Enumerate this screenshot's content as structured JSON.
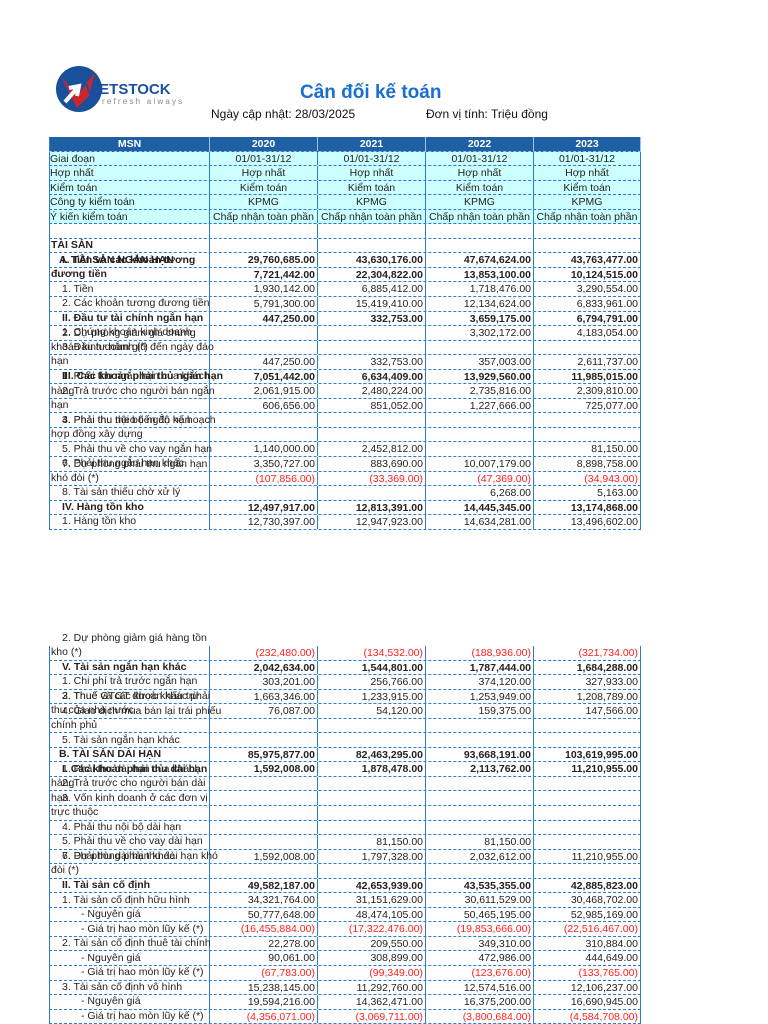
{
  "brand": {
    "name": "VIETSTOCK",
    "tagline": "refresh always",
    "color": "#1a4f9c",
    "accent": "#e02020"
  },
  "header": {
    "title": "Cân đối kế toán",
    "updated": "Ngày cập nhật: 28/03/2025",
    "unit": "Đơn vị tính: Triệu đồng"
  },
  "table": {
    "columns": [
      "MSN",
      "2020",
      "2021",
      "2022",
      "2023"
    ],
    "meta": [
      {
        "label": "Giai đoạn",
        "values": [
          "01/01-31/12",
          "01/01-31/12",
          "01/01-31/12",
          "01/01-31/12"
        ]
      },
      {
        "label": "Hợp nhất",
        "values": [
          "Hợp nhất",
          "Hợp nhất",
          "Hợp nhất",
          "Hợp nhất"
        ]
      },
      {
        "label": "Kiểm toán",
        "values": [
          "Kiểm toán",
          "Kiểm toán",
          "Kiểm toán",
          "Kiểm toán"
        ]
      },
      {
        "label": "Công ty kiểm toán",
        "values": [
          "KPMG",
          "KPMG",
          "KPMG",
          "KPMG"
        ]
      },
      {
        "label": "Ý kiến kiểm toán",
        "values": [
          "Chấp nhận toàn phần",
          "Chấp nhận toàn phần",
          "Chấp nhận toàn phần",
          "Chấp nhận toàn phần"
        ]
      }
    ],
    "rows_part1": [
      {
        "label": "",
        "kind": "section",
        "bold": false,
        "values": [
          "",
          "",
          "",
          ""
        ]
      },
      {
        "label": "TÀI SẢN",
        "kind": "section",
        "bold": true,
        "values": [
          "",
          "",
          "",
          ""
        ]
      },
      {
        "label": "A. TÀI SẢN NGẮN HẠN",
        "kind": "group",
        "bold": true,
        "values": [
          "29,760,685.00",
          "43,630,176.00",
          "47,674,624.00",
          "43,763,477.00"
        ]
      },
      {
        "label": "I. Tiền và các khoản tương đương tiền",
        "kind": "item",
        "bold": true,
        "values": [
          "7,721,442.00",
          "22,304,822.00",
          "13,853,100.00",
          "10,124,515.00"
        ]
      },
      {
        "label": "1. Tiền",
        "kind": "item",
        "bold": false,
        "values": [
          "1,930,142.00",
          "6,885,412.00",
          "1,718,476.00",
          "3,290,554.00"
        ]
      },
      {
        "label": "2. Các khoản tương đương tiền",
        "kind": "item",
        "bold": false,
        "values": [
          "5,791,300.00",
          "15,419,410.00",
          "12,134,624.00",
          "6,833,961.00"
        ]
      },
      {
        "label": "II.  Đầu tư tài chính ngắn hạn",
        "kind": "item",
        "bold": true,
        "values": [
          "447,250.00",
          "332,753.00",
          "3,659,175.00",
          "6,794,791.00"
        ]
      },
      {
        "label": "1. Chứng khoán kinh doanh",
        "kind": "item",
        "bold": false,
        "values": [
          "",
          "",
          "3,302,172.00",
          "4,183,054.00"
        ]
      },
      {
        "label": "2. Dự phòng giảm giá chứng khoán kinh doanh (*)",
        "kind": "item",
        "bold": false,
        "values": [
          "",
          "",
          "",
          ""
        ]
      },
      {
        "label": "3. Đầu tư nắm giữ đến ngày đáo hạn",
        "kind": "item",
        "bold": false,
        "values": [
          "447,250.00",
          "332,753.00",
          "357,003.00",
          "2,611,737.00"
        ]
      },
      {
        "label": "III. Các khoản phải thu ngắn hạn",
        "kind": "item",
        "bold": true,
        "values": [
          "7,051,442.00",
          "6,634,409.00",
          "13,929,560.00",
          "11,985,015.00"
        ]
      },
      {
        "label": "1. Phải thu ngắn hạn của khách hàng",
        "kind": "item",
        "bold": false,
        "values": [
          "2,061,915.00",
          "2,480,224.00",
          "2,735,816.00",
          "2,309,810.00"
        ]
      },
      {
        "label": "2. Trả trước cho người bán ngắn hạn",
        "kind": "item",
        "bold": false,
        "values": [
          "606,656.00",
          "851,052.00",
          "1,227,666.00",
          "725,077.00"
        ]
      },
      {
        "label": "3. Phải thu nội bộ ngắn hạn",
        "kind": "item",
        "bold": false,
        "values": [
          "",
          "",
          "",
          ""
        ]
      },
      {
        "label": "4. Phải thu theo tiến độ kế hoạch hợp đồng xây dựng",
        "kind": "item",
        "bold": false,
        "values": [
          "",
          "",
          "",
          ""
        ]
      },
      {
        "label": "5. Phải thu về cho vay ngắn hạn",
        "kind": "item",
        "bold": false,
        "values": [
          "1,140,000.00",
          "2,452,812.00",
          "",
          "81,150.00"
        ]
      },
      {
        "label": "6. Phải thu ngắn hạn khác",
        "kind": "item",
        "bold": false,
        "values": [
          "3,350,727.00",
          "883,690.00",
          "10,007,179.00",
          "8,898,758.00"
        ]
      },
      {
        "label": "7. Dự phòng phải thu ngắn hạn khó đòi (*)",
        "kind": "item",
        "bold": false,
        "values": [
          "(107,856.00)",
          "(33,369.00)",
          "(47,369.00)",
          "(34,943.00)"
        ]
      },
      {
        "label": "8. Tài sản thiếu chờ xử lý",
        "kind": "item",
        "bold": false,
        "values": [
          "",
          "",
          "6,268.00",
          "5,163.00"
        ]
      },
      {
        "label": "IV. Hàng tồn kho",
        "kind": "item",
        "bold": true,
        "values": [
          "12,497,917.00",
          "12,813,391.00",
          "14,445,345.00",
          "13,174,868.00"
        ]
      },
      {
        "label": "1. Hàng tồn kho",
        "kind": "item",
        "bold": false,
        "values": [
          "12,730,397.00",
          "12,947,923.00",
          "14,634,281.00",
          "13,496,602.00"
        ]
      }
    ],
    "rows_part2": [
      {
        "label": "2. Dự phòng giảm giá hàng tồn kho (*)",
        "kind": "item",
        "bold": false,
        "values": [
          "(232,480.00)",
          "(134,532.00)",
          "(188,936.00)",
          "(321,734.00)"
        ]
      },
      {
        "label": "V. Tài sản ngắn hạn khác",
        "kind": "item",
        "bold": true,
        "values": [
          "2,042,634.00",
          "1,544,801.00",
          "1,787,444.00",
          "1,684,288.00"
        ]
      },
      {
        "label": "1. Chi phí trả trước ngắn hạn",
        "kind": "item",
        "bold": false,
        "values": [
          "303,201.00",
          "256,766.00",
          "374,120.00",
          "327,933.00"
        ]
      },
      {
        "label": "2. Thuế GTGT được khấu trừ",
        "kind": "item",
        "bold": false,
        "values": [
          "1,663,346.00",
          "1,233,915.00",
          "1,253,949.00",
          "1,208,789.00"
        ]
      },
      {
        "label": "3. Thuế và các khoản khác phải thu của nhà nước",
        "kind": "item",
        "bold": false,
        "values": [
          "76,087.00",
          "54,120.00",
          "159,375.00",
          "147,566.00"
        ]
      },
      {
        "label": "4. Giao dịch mua bán lại trái phiếu chính phủ",
        "kind": "item",
        "bold": false,
        "values": [
          "",
          "",
          "",
          ""
        ]
      },
      {
        "label": "5. Tài sản ngắn hạn khác",
        "kind": "item",
        "bold": false,
        "values": [
          "",
          "",
          "",
          ""
        ]
      },
      {
        "label": "B. TÀI SẢN DÀI HẠN",
        "kind": "group",
        "bold": true,
        "values": [
          "85,975,877.00",
          "82,463,295.00",
          "93,668,191.00",
          "103,619,995.00"
        ]
      },
      {
        "label": "I. Các khoản phải thu dài hạn",
        "kind": "item",
        "bold": true,
        "values": [
          "1,592,008.00",
          "1,878,478.00",
          "2,113,762.00",
          "11,210,955.00"
        ]
      },
      {
        "label": "1. Phải thu dài hạn của khách hàng",
        "kind": "item",
        "bold": false,
        "values": [
          "",
          "",
          "",
          ""
        ]
      },
      {
        "label": "2. Trả trước cho người bán dài hạn",
        "kind": "item",
        "bold": false,
        "values": [
          "",
          "",
          "",
          ""
        ]
      },
      {
        "label": "3. Vốn kinh doanh ở các đơn vị trực thuộc",
        "kind": "item",
        "bold": false,
        "values": [
          "",
          "",
          "",
          ""
        ]
      },
      {
        "label": "4.  Phải thu nội bộ dài hạn",
        "kind": "item",
        "bold": false,
        "values": [
          "",
          "",
          "",
          ""
        ]
      },
      {
        "label": "5. Phải thu về cho vay dài hạn",
        "kind": "item",
        "bold": false,
        "values": [
          "",
          "81,150.00",
          "81,150.00",
          ""
        ]
      },
      {
        "label": "6. Phải thu dài hạn khác",
        "kind": "item",
        "bold": false,
        "values": [
          "1,592,008.00",
          "1,797,328.00",
          "2,032,612.00",
          "11,210,955.00"
        ]
      },
      {
        "label": "7. Dự phòng phải thu dài hạn khó đòi (*)",
        "kind": "item",
        "bold": false,
        "values": [
          "",
          "",
          "",
          ""
        ]
      },
      {
        "label": "II. Tài sản cố định",
        "kind": "item",
        "bold": true,
        "values": [
          "49,582,187.00",
          "42,653,939.00",
          "43,535,355.00",
          "42,885,823.00"
        ]
      },
      {
        "label": "1. Tài sản cố định hữu hình",
        "kind": "item",
        "bold": false,
        "values": [
          "34,321,764.00",
          "31,151,629.00",
          "30,611,529.00",
          "30,468,702.00"
        ]
      },
      {
        "label": "- Nguyên giá",
        "kind": "sub",
        "bold": false,
        "values": [
          "50,777,648.00",
          "48,474,105.00",
          "50,465,195.00",
          "52,985,169.00"
        ]
      },
      {
        "label": "- Giá trị hao mòn lũy kế (*)",
        "kind": "sub",
        "bold": false,
        "values": [
          "(16,455,884.00)",
          "(17,322,476.00)",
          "(19,853,666.00)",
          "(22,516,467.00)"
        ]
      },
      {
        "label": "2. Tài sản cố định thuê tài chính",
        "kind": "item",
        "bold": false,
        "values": [
          "22,278.00",
          "209,550.00",
          "349,310.00",
          "310,884.00"
        ]
      },
      {
        "label": "- Nguyên giá",
        "kind": "sub",
        "bold": false,
        "values": [
          "90,061.00",
          "308,899.00",
          "472,986.00",
          "444,649.00"
        ]
      },
      {
        "label": "- Giá trị hao mòn lũy kế (*)",
        "kind": "sub",
        "bold": false,
        "values": [
          "(67,783.00)",
          "(99,349.00)",
          "(123,676.00)",
          "(133,765.00)"
        ]
      },
      {
        "label": "3. Tài sản cố định vô hình",
        "kind": "item",
        "bold": false,
        "values": [
          "15,238,145.00",
          "11,292,760.00",
          "12,574,516.00",
          "12,106,237.00"
        ]
      },
      {
        "label": "- Nguyên giá",
        "kind": "sub",
        "bold": false,
        "values": [
          "19,594,216.00",
          "14,362,471.00",
          "16,375,200.00",
          "16,690,945.00"
        ]
      },
      {
        "label": "- Giá trị hao mòn lũy kế (*)",
        "kind": "sub",
        "bold": false,
        "values": [
          "(4,356,071.00)",
          "(3,069,711.00)",
          "(3,800,684.00)",
          "(4,584,708.00)"
        ]
      }
    ]
  }
}
